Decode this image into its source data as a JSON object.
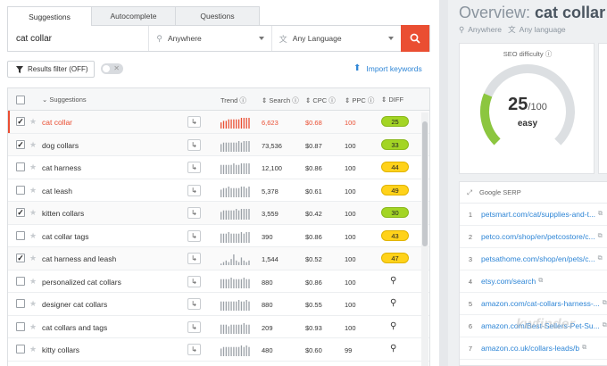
{
  "tabs": [
    {
      "label": "Suggestions",
      "active": true
    },
    {
      "label": "Autocomplete",
      "active": false
    },
    {
      "label": "Questions",
      "active": false
    }
  ],
  "search": {
    "keyword": "cat collar",
    "location": "Anywhere",
    "language": "Any Language"
  },
  "toolbar": {
    "filter_label": "Results filter (OFF)",
    "import_label": "Import keywords"
  },
  "table": {
    "headers": {
      "suggestions": "Suggestions",
      "trend": "Trend",
      "search": "Search",
      "cpc": "CPC",
      "ppc": "PPC",
      "diff": "DIFF"
    },
    "rows": [
      {
        "keyword": "cat collar",
        "checked": true,
        "highlighted": true,
        "search": "6,623",
        "cpc": "$0.68",
        "ppc": "100",
        "diff": "25",
        "level": "green",
        "trend": [
          4,
          5,
          5,
          6,
          6,
          6,
          6,
          6,
          7,
          7,
          7,
          7
        ]
      },
      {
        "keyword": "dog collars",
        "checked": true,
        "search": "73,536",
        "cpc": "$0.87",
        "ppc": "100",
        "diff": "33",
        "level": "green",
        "trend": [
          5,
          6,
          6,
          6,
          6,
          6,
          6,
          7,
          6,
          7,
          7,
          7
        ]
      },
      {
        "keyword": "cat harness",
        "checked": false,
        "search": "12,100",
        "cpc": "$0.86",
        "ppc": "100",
        "diff": "44",
        "level": "yellow",
        "trend": [
          6,
          6,
          6,
          6,
          6,
          7,
          6,
          6,
          7,
          7,
          7,
          7
        ]
      },
      {
        "keyword": "cat leash",
        "checked": false,
        "search": "5,378",
        "cpc": "$0.61",
        "ppc": "100",
        "diff": "49",
        "level": "yellow",
        "trend": [
          5,
          6,
          6,
          7,
          6,
          6,
          6,
          6,
          7,
          7,
          6,
          7
        ]
      },
      {
        "keyword": "kitten collars",
        "checked": true,
        "search": "3,559",
        "cpc": "$0.42",
        "ppc": "100",
        "diff": "30",
        "level": "green",
        "trend": [
          5,
          6,
          6,
          6,
          6,
          6,
          7,
          6,
          7,
          7,
          7,
          7
        ]
      },
      {
        "keyword": "cat collar tags",
        "checked": false,
        "search": "390",
        "cpc": "$0.86",
        "ppc": "100",
        "diff": "43",
        "level": "yellow",
        "trend": [
          6,
          6,
          6,
          7,
          6,
          6,
          6,
          6,
          7,
          6,
          7,
          7
        ]
      },
      {
        "keyword": "cat harness and leash",
        "checked": true,
        "search": "1,544",
        "cpc": "$0.52",
        "ppc": "100",
        "diff": "47",
        "level": "yellow",
        "trend": [
          1,
          2,
          3,
          2,
          4,
          7,
          3,
          2,
          5,
          3,
          2,
          3
        ]
      },
      {
        "keyword": "personalized cat collars",
        "checked": false,
        "search": "880",
        "cpc": "$0.86",
        "ppc": "100",
        "diff": "",
        "level": "none",
        "trend": [
          6,
          6,
          6,
          6,
          7,
          6,
          6,
          6,
          6,
          7,
          6,
          6
        ]
      },
      {
        "keyword": "designer cat collars",
        "checked": false,
        "search": "880",
        "cpc": "$0.55",
        "ppc": "100",
        "diff": "",
        "level": "none",
        "trend": [
          6,
          6,
          6,
          6,
          6,
          6,
          6,
          7,
          6,
          6,
          7,
          6
        ]
      },
      {
        "keyword": "cat collars and tags",
        "checked": false,
        "search": "209",
        "cpc": "$0.93",
        "ppc": "100",
        "diff": "",
        "level": "none",
        "trend": [
          6,
          6,
          6,
          5,
          6,
          6,
          6,
          6,
          6,
          7,
          6,
          6
        ]
      },
      {
        "keyword": "kitty collars",
        "checked": false,
        "search": "480",
        "cpc": "$0.60",
        "ppc": "99",
        "diff": "",
        "level": "none",
        "trend": [
          5,
          6,
          6,
          6,
          6,
          6,
          6,
          6,
          7,
          6,
          7,
          6
        ]
      }
    ]
  },
  "overview": {
    "prefix": "Overview:",
    "keyword": "cat collar",
    "location": "Anywhere",
    "language": "Any language",
    "seo_label": "SEO difficulty",
    "seo_value": "25",
    "seo_scale": "/100",
    "seo_word": "easy",
    "seo_fraction": 0.25
  },
  "serp": {
    "label": "Google SERP",
    "results": [
      {
        "n": "1",
        "url": "petsmart.com/cat/supplies-and-t..."
      },
      {
        "n": "2",
        "url": "petco.com/shop/en/petcostore/c..."
      },
      {
        "n": "3",
        "url": "petsathome.com/shop/en/pets/c..."
      },
      {
        "n": "4",
        "url": "etsy.com/search"
      },
      {
        "n": "5",
        "url": "amazon.com/cat-collars-harness-..."
      },
      {
        "n": "6",
        "url": "amazon.com/Best-Sellers-Pet-Su..."
      },
      {
        "n": "7",
        "url": "amazon.co.uk/collars-leads/b"
      }
    ]
  },
  "watermark": "kwfinder",
  "colors": {
    "accent": "#ea4e32",
    "link": "#2f86d6",
    "green": "#a3d524",
    "yellow": "#ffd21a"
  }
}
